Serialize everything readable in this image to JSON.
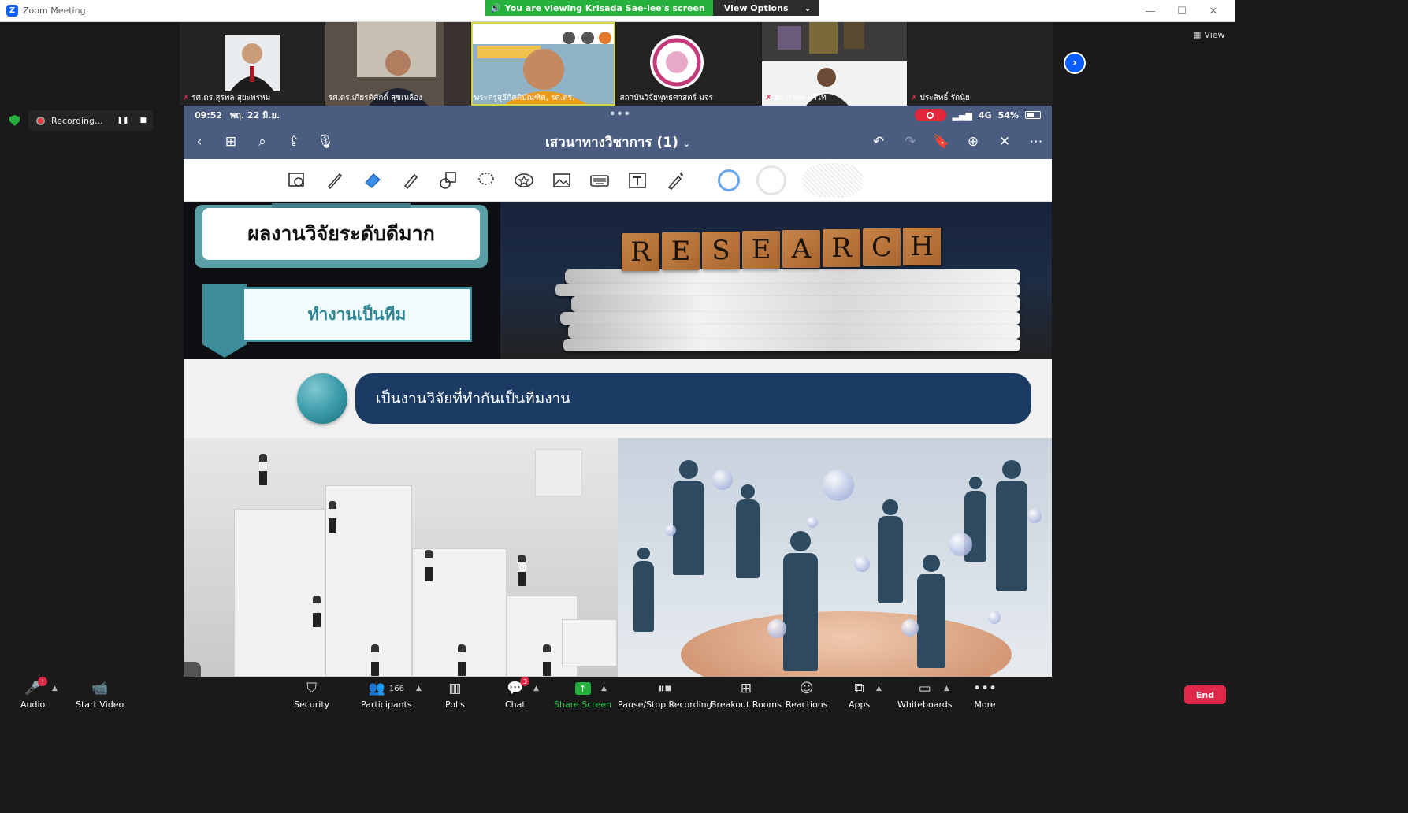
{
  "window": {
    "title": "Zoom Meeting",
    "share_banner": "You are viewing Krisada Sae-lee's screen",
    "view_options": "View Options",
    "view_label": "View"
  },
  "recording": {
    "label": "Recording..."
  },
  "participants_gallery": [
    {
      "name": "รศ.ดร.สุรพล สุยะพรหม",
      "muted": true
    },
    {
      "name": "รศ.ดร.เกียรติศักดิ์ สุขเหลือง",
      "muted": false
    },
    {
      "name": "พระครูสุธีกิตติบัณฑิต, รศ.ดร.",
      "muted": false,
      "active": true
    },
    {
      "name": "สถาบันวิจัยพุทธศาสตร์ มจร",
      "muted": false
    },
    {
      "name": "ดร.กำพล ศรีไท",
      "muted": true
    },
    {
      "name": "ประสิทธิ์ รักนุ้ย",
      "muted": true
    }
  ],
  "ipad": {
    "status_time": "09:52",
    "status_date": "พฤ. 22 มิ.ย.",
    "status_network": "4G",
    "status_battery": "54%",
    "doc_title": "เสวนาทางวิชาการ (1)"
  },
  "slide": {
    "title": "ผลงานวิจัยระดับดีมาก",
    "subtitle": "ทำงานเป็นทีม",
    "research_letters": [
      "R",
      "E",
      "S",
      "E",
      "A",
      "R",
      "C",
      "H"
    ],
    "description": "เป็นงานวิจัยที่ทำกันเป็นทีมงาน"
  },
  "toolbar": {
    "audio": "Audio",
    "start_video": "Start Video",
    "security": "Security",
    "participants": "Participants",
    "participants_count": "166",
    "polls": "Polls",
    "chat": "Chat",
    "chat_badge": "3",
    "share_screen": "Share Screen",
    "pause_stop_recording": "Pause/Stop Recording",
    "breakout_rooms": "Breakout Rooms",
    "reactions": "Reactions",
    "apps": "Apps",
    "whiteboards": "Whiteboards",
    "more": "More",
    "end": "End"
  },
  "colors": {
    "zoom_blue": "#0b5cff",
    "share_green": "#26b13c",
    "end_red": "#e0284a",
    "ipad_header": "#4a5c80",
    "slide_navy": "#1b3b65",
    "slide_teal": "#3c8d99"
  }
}
